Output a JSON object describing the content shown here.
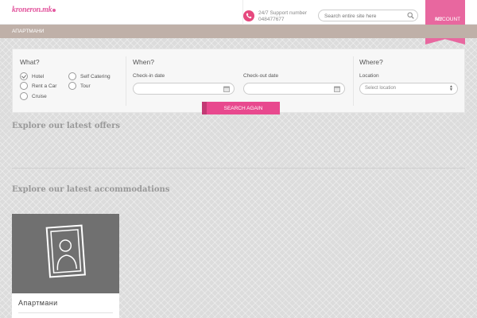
{
  "header": {
    "logo": "kroneron.mk",
    "support_label": "24/7 Support number",
    "support_number": "048477677",
    "search_placeholder": "Search entire site here",
    "account_line1": "MY",
    "account_line2": "ACCOUNT"
  },
  "breadcrumb": "АПАРТМАНИ",
  "search_panel": {
    "what_title": "What?",
    "when_title": "When?",
    "where_title": "Where?",
    "options": [
      {
        "label": "Hotel",
        "checked": true
      },
      {
        "label": "Self Catering",
        "checked": false
      },
      {
        "label": "Rent a Car",
        "checked": false
      },
      {
        "label": "Tour",
        "checked": false
      },
      {
        "label": "Cruise",
        "checked": false
      }
    ],
    "checkin_label": "Check-in date",
    "checkout_label": "Check-out date",
    "location_label": "Location",
    "location_value": "Select location",
    "button_label": "SEARCH AGAIN"
  },
  "offers_title": "Explore our latest offers",
  "accommodations_title": "Explore our latest accommodations",
  "accommodations": [
    {
      "title": "Апартмани"
    }
  ],
  "colors": {
    "accent": "#e8498e",
    "account_tab": "#e8679f",
    "breadcrumb_bar": "#bfb0a8"
  }
}
